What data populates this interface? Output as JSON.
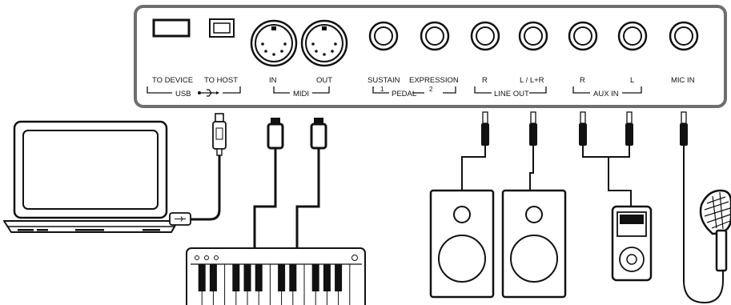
{
  "panel": {
    "usb": {
      "to_device": "TO DEVICE",
      "to_host": "TO HOST",
      "group_label": "USB"
    },
    "midi": {
      "in": "IN",
      "out": "OUT",
      "group_label": "MIDI"
    },
    "pedal": {
      "sustain": "SUSTAIN",
      "expression": "EXPRESSION",
      "num_1": "1",
      "num_2": "2",
      "group_label": "PEDAL"
    },
    "line_out": {
      "r": "R",
      "l": "L / L+R",
      "group_label": "LINE OUT"
    },
    "aux_in": {
      "r": "R",
      "l": "L",
      "group_label": "AUX IN"
    },
    "mic_in": "MIC IN"
  },
  "devices": {
    "laptop": "laptop-computer",
    "keyboard": "midi-keyboard",
    "speakers": "speaker-pair",
    "player": "portable-music-player",
    "microphone": "microphone"
  },
  "icons": {
    "usb_symbol": "usb-trident-icon"
  },
  "colors": {
    "line": "#111111",
    "background": "#ffffff"
  }
}
